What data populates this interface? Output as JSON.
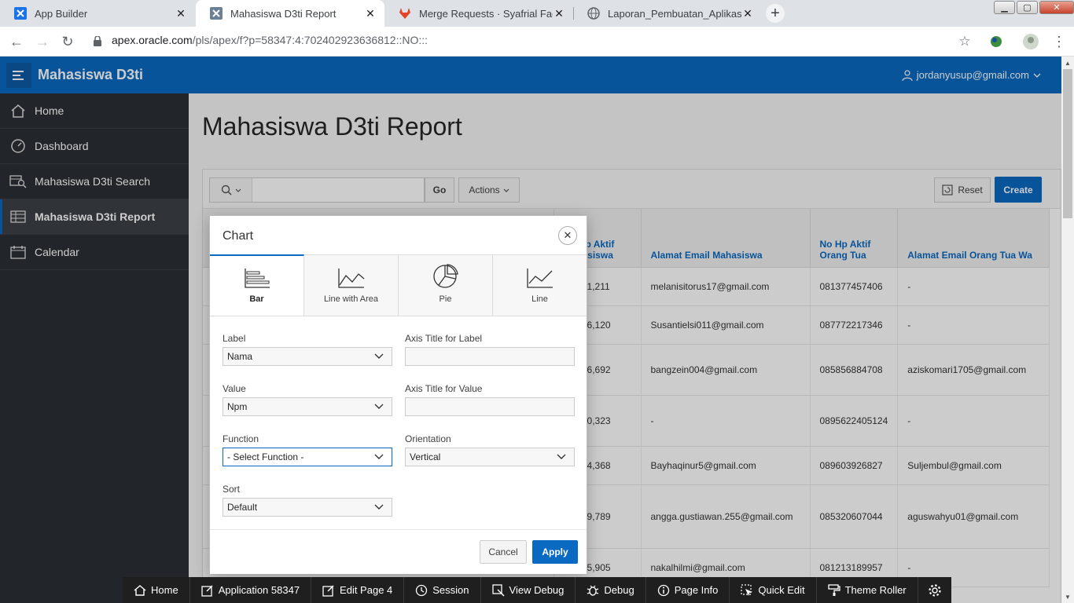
{
  "browser": {
    "tabs": [
      {
        "title": "App Builder",
        "icon": "apex-icon"
      },
      {
        "title": "Mahasiswa D3ti Report",
        "icon": "apex-icon"
      },
      {
        "title": "Merge Requests · Syafrial Fachri",
        "icon": "gitlab-icon"
      },
      {
        "title": "Laporan_Pembuatan_Aplikasi_D",
        "icon": "globe-icon"
      }
    ],
    "url_host": "apex.oracle.com",
    "url_path": "/pls/apex/f?p=58347:4:702402923636812::NO:::"
  },
  "app": {
    "title": "Mahasiswa D3ti",
    "user": "jordanyusup@gmail.com"
  },
  "sidebar": {
    "items": [
      {
        "label": "Home",
        "icon": "home-icon"
      },
      {
        "label": "Dashboard",
        "icon": "dashboard-icon"
      },
      {
        "label": "Mahasiswa D3ti Search",
        "icon": "search-report-icon"
      },
      {
        "label": "Mahasiswa D3ti Report",
        "icon": "table-icon"
      },
      {
        "label": "Calendar",
        "icon": "calendar-icon"
      }
    ]
  },
  "page": {
    "title": "Mahasiswa D3ti Report"
  },
  "toolbar": {
    "go_label": "Go",
    "actions_label": "Actions",
    "reset_label": "Reset",
    "create_label": "Create"
  },
  "report": {
    "columns": [
      "No Hp Aktif Mahasiswa",
      "Alamat Email Mahasiswa",
      "No Hp Aktif Orang Tua",
      "Alamat Email Orang Tua Wa"
    ],
    "rows": [
      [
        "40,741,211",
        "melanisitorus17@gmail.com",
        "081377457406",
        "-"
      ],
      [
        "27,366,120",
        "Susantielsi011@gmail.com",
        "087772217346",
        "-"
      ],
      [
        "12,766,692",
        "bangzein004@gmail.com",
        "085856884708",
        "aziskomari1705@gmail.com"
      ],
      [
        "95,570,323",
        "-",
        "0895622405124",
        "-"
      ],
      [
        "55,254,368",
        "Bayhaqinur5@gmail.com",
        "089603926827",
        "Suljembul@gmail.com"
      ],
      [
        "18,189,789",
        "angga.gustiawan.255@gmail.com",
        "085320607044",
        "aguswahyu01@gmail.com"
      ],
      [
        "21,575,905",
        "nakalhilmi@gmail.com",
        "081213189957",
        "-"
      ]
    ]
  },
  "dialog": {
    "title": "Chart",
    "chart_types": [
      {
        "label": "Bar",
        "icon": "bar-chart-icon"
      },
      {
        "label": "Line with Area",
        "icon": "area-chart-icon"
      },
      {
        "label": "Pie",
        "icon": "pie-chart-icon"
      },
      {
        "label": "Line",
        "icon": "line-chart-icon"
      }
    ],
    "label_field": {
      "label": "Label",
      "value": "Nama"
    },
    "axis_label_field": {
      "label": "Axis Title for Label",
      "value": ""
    },
    "value_field": {
      "label": "Value",
      "value": "Npm"
    },
    "axis_value_field": {
      "label": "Axis Title for Value",
      "value": ""
    },
    "function_field": {
      "label": "Function",
      "value": "- Select Function -"
    },
    "orientation_field": {
      "label": "Orientation",
      "value": "Vertical"
    },
    "sort_field": {
      "label": "Sort",
      "value": "Default"
    },
    "cancel_label": "Cancel",
    "apply_label": "Apply"
  },
  "dev_toolbar": {
    "items": [
      {
        "label": "Home",
        "icon": "home-icon"
      },
      {
        "label": "Application 58347",
        "icon": "edit-icon"
      },
      {
        "label": "Edit Page 4",
        "icon": "edit-icon"
      },
      {
        "label": "Session",
        "icon": "clock-icon"
      },
      {
        "label": "View Debug",
        "icon": "debug-view-icon"
      },
      {
        "label": "Debug",
        "icon": "bug-icon"
      },
      {
        "label": "Page Info",
        "icon": "info-icon"
      },
      {
        "label": "Quick Edit",
        "icon": "cursor-icon"
      },
      {
        "label": "Theme Roller",
        "icon": "paint-roller-icon"
      },
      {
        "label": "",
        "icon": "gear-icon"
      }
    ]
  },
  "colors": {
    "brand": "#0a6ac2",
    "sidebar": "#2b3035"
  }
}
